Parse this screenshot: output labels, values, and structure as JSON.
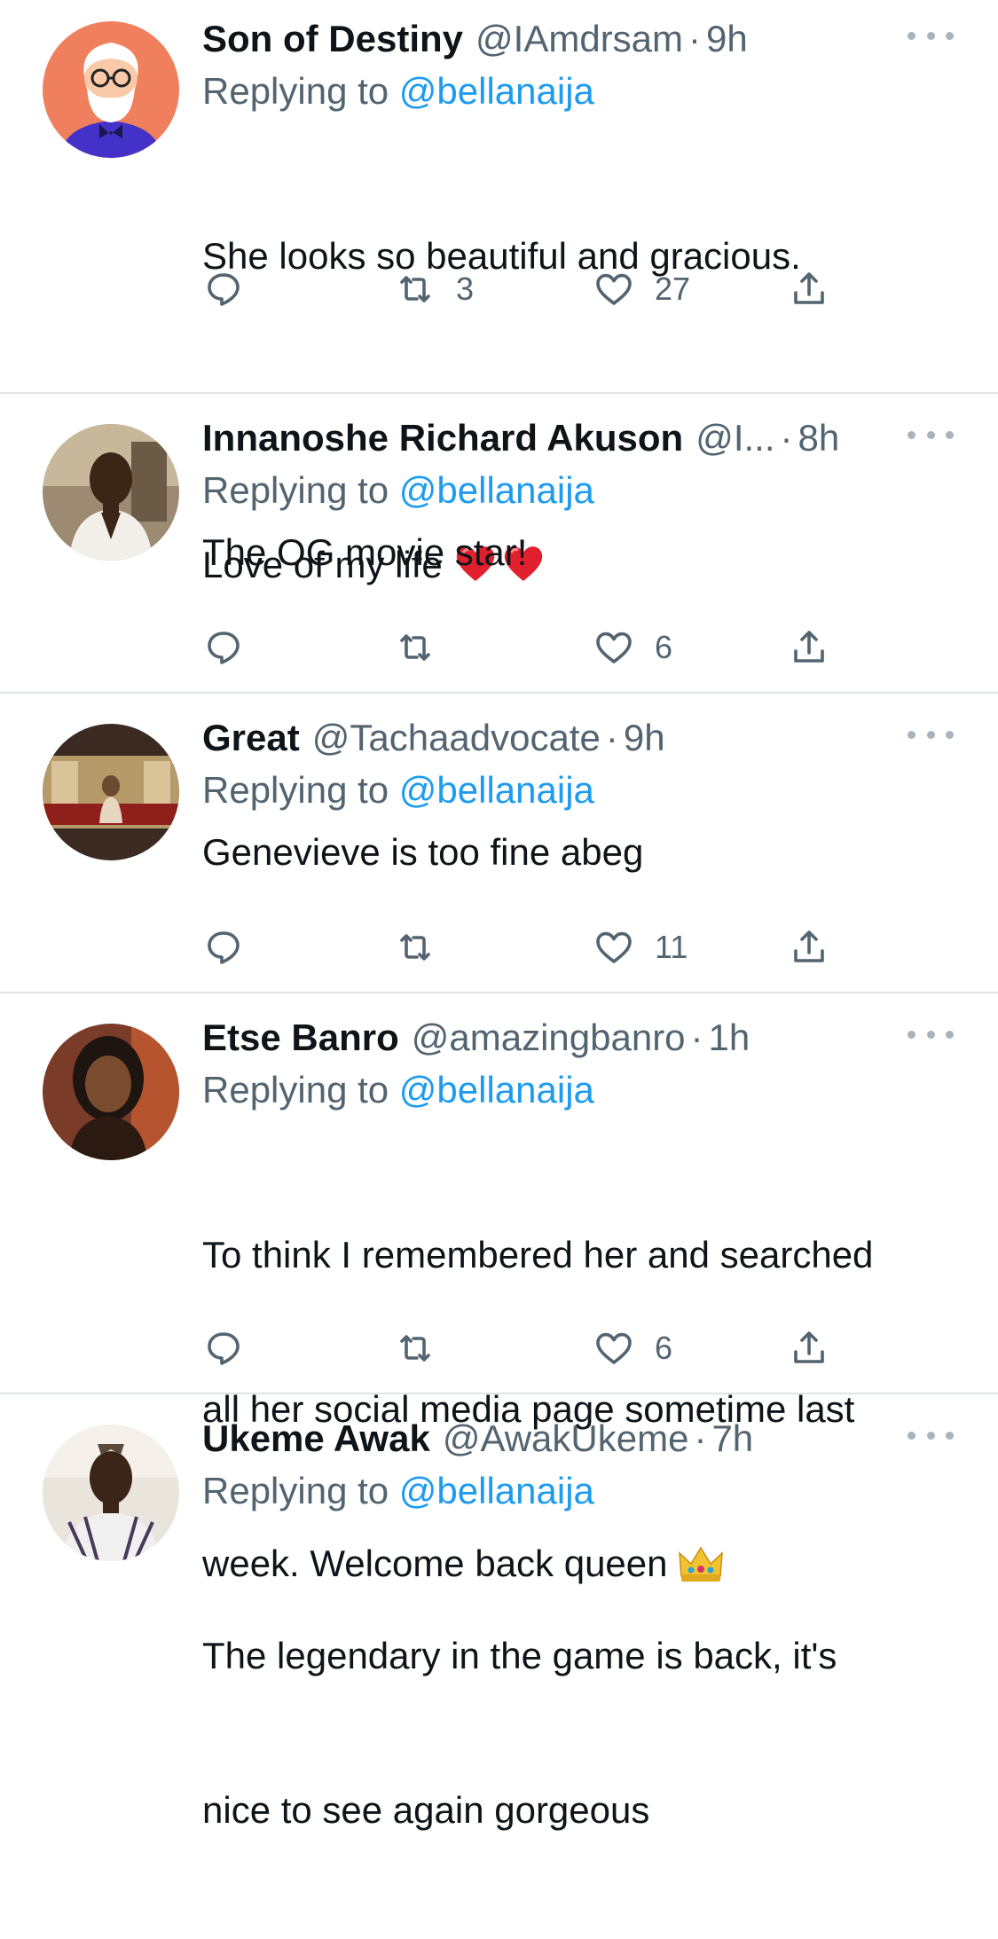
{
  "colors": {
    "text": "#0f1419",
    "secondary": "#536471",
    "link": "#1d9bf0",
    "divider": "#e1e4e6",
    "heart_emoji": "#e0202e",
    "crown": "#f2c230"
  },
  "tweets": [
    {
      "name": "Son of Destiny",
      "handle": "@IAmdrsam",
      "dot": "·",
      "time": "9h",
      "replying_prefix": "Replying to ",
      "replying_to": "@bellanaija",
      "text_line1": "She looks so beautiful and gracious.",
      "text_line2": "Love of my life ",
      "emoji": [
        "red-heart-emoji",
        "red-heart-emoji"
      ],
      "retweets": "3",
      "likes": "27"
    },
    {
      "name": "Innanoshe Richard Akuson",
      "handle": "@I...",
      "dot": "·",
      "time": "8h",
      "replying_prefix": "Replying to ",
      "replying_to": "@bellanaija",
      "text": "The OG movie star!",
      "retweets": "",
      "likes": "6"
    },
    {
      "name": "Great",
      "handle": "@Tachaadvocate",
      "dot": "·",
      "time": "9h",
      "replying_prefix": "Replying to ",
      "replying_to": "@bellanaija",
      "text": "Genevieve is too fine abeg",
      "retweets": "",
      "likes": "11"
    },
    {
      "name": "Etse Banro",
      "handle": "@amazingbanro",
      "dot": "·",
      "time": "1h",
      "replying_prefix": "Replying to ",
      "replying_to": "@bellanaija",
      "text_line1": "To think I remembered her and searched",
      "text_line2": "all her social media page sometime last",
      "text_line3": "week. Welcome back queen ",
      "emoji": [
        "crown-emoji"
      ],
      "retweets": "",
      "likes": "6"
    },
    {
      "name": "Ukeme Awak",
      "handle": "@AwakUkeme",
      "dot": "·",
      "time": "7h",
      "replying_prefix": "Replying to ",
      "replying_to": "@bellanaija",
      "text_line1": "The legendary in the game is back, it's",
      "text_line2": "nice to see again gorgeous"
    }
  ]
}
